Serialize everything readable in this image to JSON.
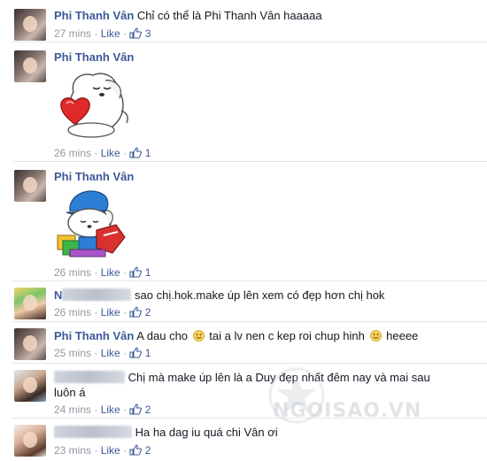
{
  "comments": [
    {
      "author": "Phi Thanh Vân",
      "text": "Chỉ có thể là Phi Thanh Vân haaaaa",
      "time": "27 mins",
      "like_label": "Like",
      "likes": "3"
    },
    {
      "author": "Phi Thanh Vân",
      "text": "",
      "time": "26 mins",
      "like_label": "Like",
      "likes": "1",
      "sticker": "dog-hugging-heart-sticker"
    },
    {
      "author": "Phi Thanh Vân",
      "text": "",
      "time": "26 mins",
      "like_label": "Like",
      "likes": "1",
      "sticker": "dog-with-cap-and-gifts-sticker"
    },
    {
      "author_visible": "N",
      "text": "sao chị.hok.make úp lên xem có đẹp hơn chị hok",
      "time": "26 mins",
      "like_label": "Like",
      "likes": "2"
    },
    {
      "author": "Phi Thanh Vân",
      "text_part1": "A dau cho",
      "text_part2": "tai a lv nen c kep roi chup hinh",
      "text_part3": "heeee",
      "time": "25 mins",
      "like_label": "Like",
      "likes": "1"
    },
    {
      "text": "Chị mà make úp lên là a Duy đẹp nhất đêm nay và mai sau luôn á",
      "time": "24 mins",
      "like_label": "Like",
      "likes": "2"
    },
    {
      "text": "Ha ha dag iu quá chi Vân ơi",
      "time": "23 mins",
      "like_label": "Like",
      "likes": "2"
    }
  ],
  "separator": "·",
  "watermark": "NGOISAO.VN",
  "colors": {
    "link": "#3b5998",
    "meta": "#9197a3",
    "text": "#141823",
    "separator": "#e5e6e9"
  },
  "icons": {
    "like": "thumbs-up-icon",
    "smiley": "smiley-emoticon-icon"
  }
}
